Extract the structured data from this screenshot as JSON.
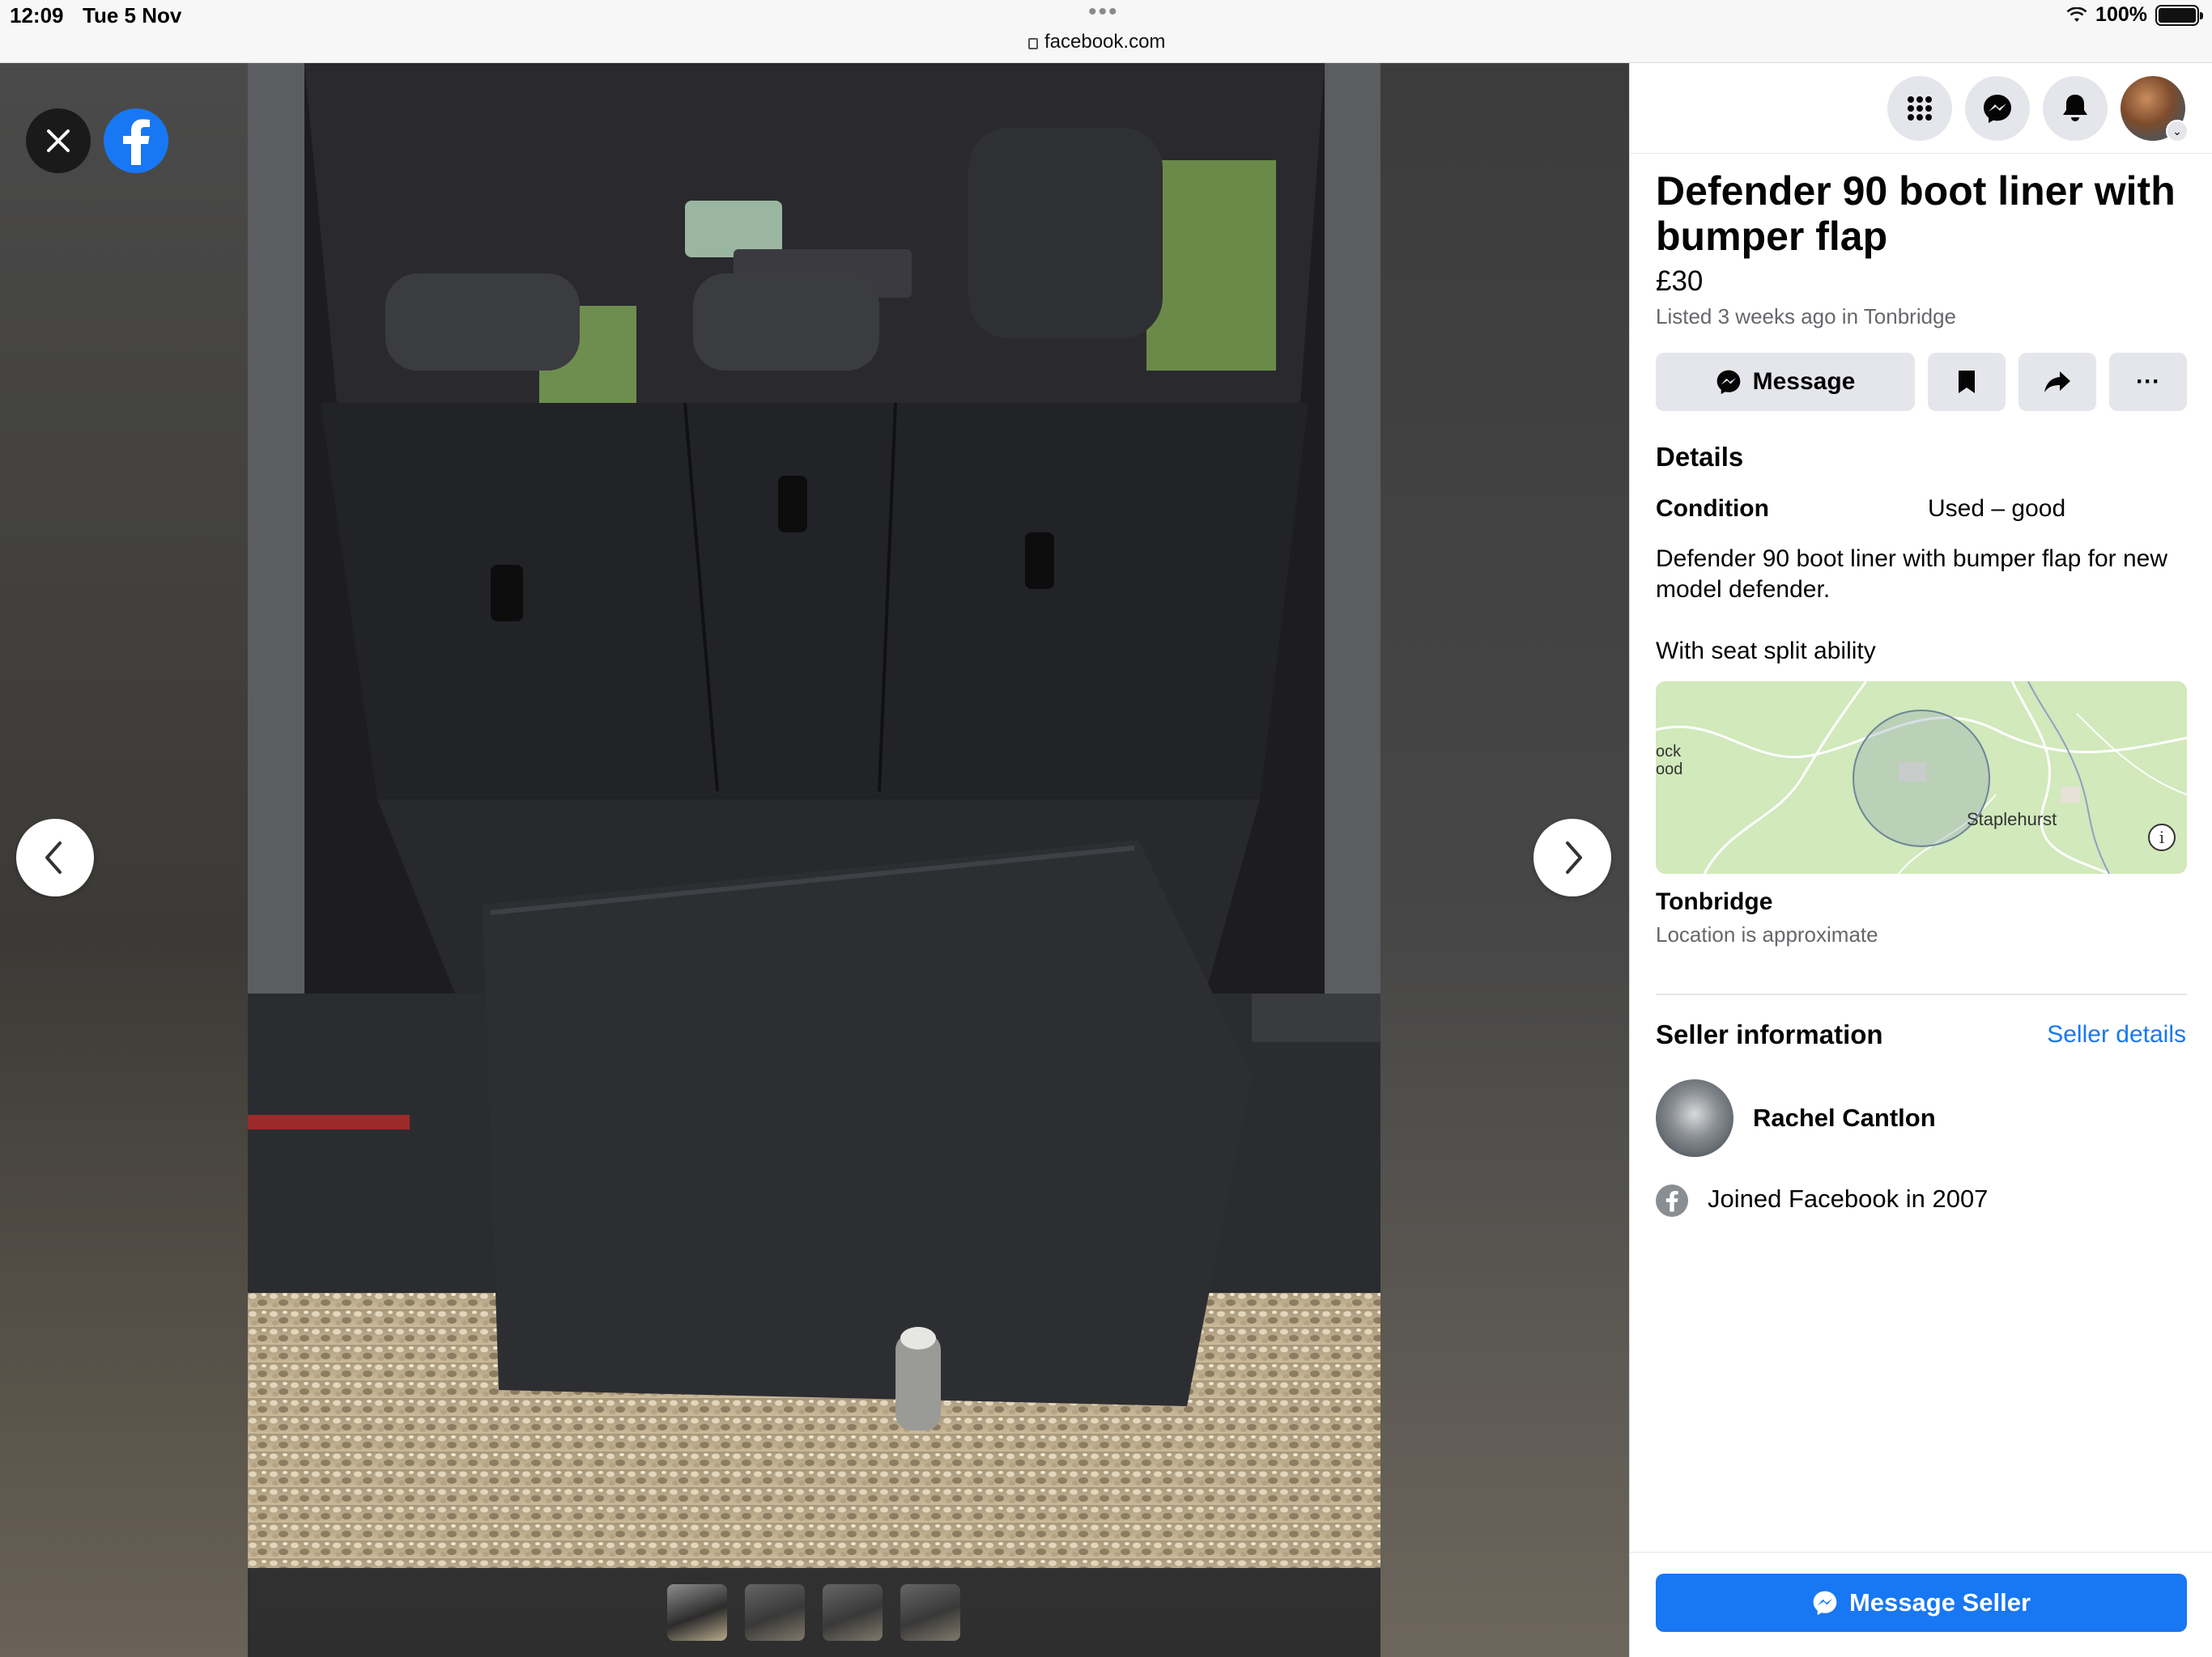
{
  "status_bar": {
    "time": "12:09",
    "date": "Tue 5 Nov",
    "url": "facebook.com",
    "battery": "100%"
  },
  "viewer": {
    "close_icon": "close-icon",
    "logo_icon": "facebook-logo-icon",
    "prev_icon": "chevron-left-icon",
    "next_icon": "chevron-right-icon",
    "thumbnail_count": 4,
    "active_thumbnail": 1
  },
  "topbar": {
    "icons": [
      "menu-grid-icon",
      "messenger-icon",
      "bell-icon",
      "profile-avatar"
    ]
  },
  "listing": {
    "title": "Defender 90 boot liner with bumper flap",
    "price": "£30",
    "listed": "Listed 3 weeks ago in Tonbridge",
    "message_label": "Message",
    "more_label": "···"
  },
  "details": {
    "heading": "Details",
    "condition_label": "Condition",
    "condition_value": "Used – good",
    "description_line1": "Defender 90 boot liner with bumper flap for new model defender.",
    "description_line2": "With seat split ability"
  },
  "map": {
    "label_left": "ock\nood",
    "label_town": "Staplehurst",
    "info": "i"
  },
  "location": {
    "name": "Tonbridge",
    "note": "Location is approximate"
  },
  "seller": {
    "heading": "Seller information",
    "details_link": "Seller details",
    "name": "Rachel Cantlon",
    "joined": "Joined Facebook in 2007"
  },
  "footer": {
    "cta": "Message Seller"
  },
  "colors": {
    "brand_blue": "#1877f2",
    "button_grey": "#e4e6eb",
    "secondary_text": "#65676b"
  }
}
